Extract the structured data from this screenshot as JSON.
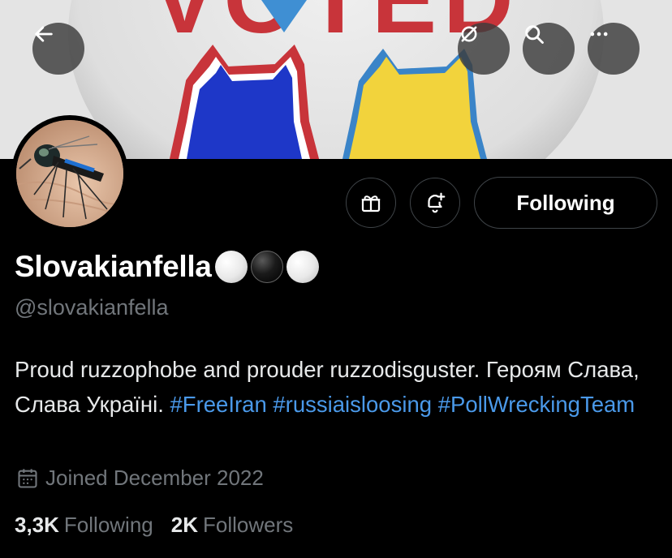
{
  "banner": {
    "text": "VOTED"
  },
  "profile": {
    "display_name": "Slovakianfella",
    "handle": "@slovakianfella",
    "bio": {
      "text": "Proud ruzzophobe and prouder ruzzodisguster. Героям Слава, Слава Україні.",
      "hashtags": [
        "#FreeIran",
        "#russiaisloosing",
        "#PollWreckingTeam"
      ]
    },
    "joined": "Joined December 2022",
    "stats": {
      "following_count": "3,3K",
      "following_label": "Following",
      "followers_count": "2K",
      "followers_label": "Followers"
    }
  },
  "actions": {
    "follow_state_label": "Following"
  },
  "colors": {
    "link": "#4a99e9",
    "secondary_text": "#71767b",
    "background": "#000000"
  },
  "icons": [
    "back-arrow-icon",
    "hide-links-icon",
    "search-icon",
    "more-icon",
    "gift-icon",
    "bell-plus-icon",
    "calendar-icon"
  ]
}
